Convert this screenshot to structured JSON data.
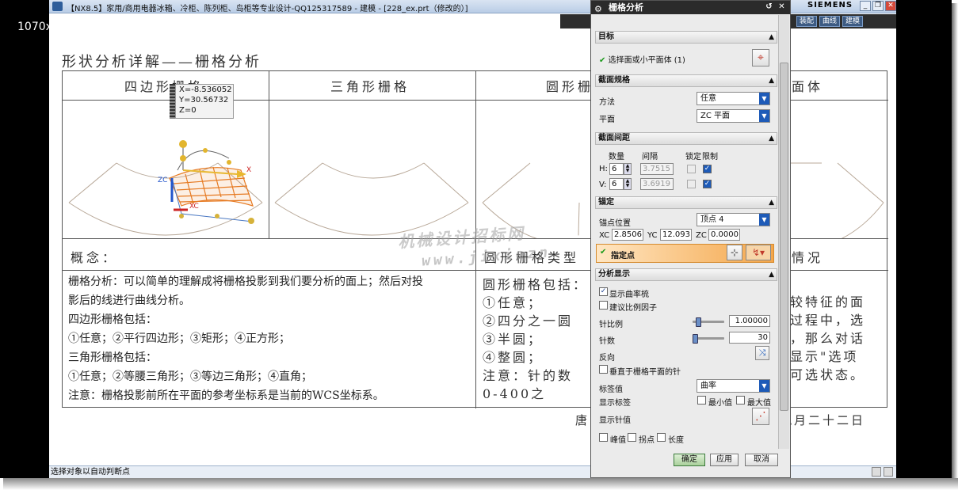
{
  "overlay": {
    "resolution_label": "1070x604(78%)"
  },
  "app": {
    "title": "【NX8.5】家用/商用电器冰箱、冷柜、陈列柜、岛柜等专业设计-QQ125317589 - 建模 - [228_ex.prt（修改的）]",
    "brand": "SIEMENS",
    "ribbon_tabs": [
      "装配",
      "曲线",
      "建模"
    ],
    "status_text": "选择对象以自动判断点"
  },
  "drawing": {
    "doc_title": "形状分析详解——栅格分析",
    "column_headers": [
      "四边形栅格",
      "三角形栅格",
      "圆形栅格",
      "曲面体"
    ],
    "concept_label": "概念：",
    "circle_type_label": "圆形栅格类型",
    "situation_label": "情况",
    "left_lines": [
      "栅格分析：可以简单的理解成将栅格投影到我们要分析的面上；然后对投",
      "影后的线进行曲线分析。",
      "四边形栅格包括：",
      "①任意；②平行四边形；③矩形；④正方形；",
      "三角形栅格包括：",
      "①任意；②等腰三角形；③等边三角形；④直角；",
      "注意：栅格投影前所在平面的参考坐标系是当前的WCS坐标系。"
    ],
    "mid_lines": [
      "圆形栅格包括：",
      "①任意；",
      "②四分之一圆",
      "③半圆；",
      "④整圆；",
      "注意：针的数",
      "0-400之"
    ],
    "right_lines": [
      "较特征的面",
      "过程中，选",
      "，那么对话",
      "显示\"选项",
      "可选状态。"
    ],
    "date_left": "唐",
    "date_right": "九月二十二日",
    "watermark_line1": "机械设计招标网",
    "watermark_line2": "www.jixiezn",
    "coord_tip": {
      "x": "X=-8.536052",
      "y": "Y=30.56732",
      "z": "Z=0"
    },
    "axis_labels": {
      "zc": "ZC",
      "xc": "XC",
      "x": "X"
    }
  },
  "dialog": {
    "title": "栅格分析",
    "target": {
      "header": "目标",
      "select_label": "选择面或小平面体 (1)"
    },
    "section_spec": {
      "header": "截面规格",
      "method_label": "方法",
      "method_value": "任意",
      "plane_label": "平面",
      "plane_value": "ZC 平面"
    },
    "spacing": {
      "header": "截面间距",
      "col_count": "数量",
      "col_interval": "间隔",
      "col_lock": "锁定",
      "col_limit": "限制",
      "h_label": "H:",
      "h_count": "6",
      "h_interval": "3.7515",
      "v_label": "V:",
      "v_count": "6",
      "v_interval": "3.6919"
    },
    "anchor": {
      "header": "锚定",
      "pos_label": "锚点位置",
      "pos_value": "顶点 4",
      "xc_label": "XC",
      "xc_value": "2.8506",
      "yc_label": "YC",
      "yc_value": "12.093",
      "zc_label": "ZC",
      "zc_value": "0.0000",
      "specify_label": "指定点"
    },
    "analysis": {
      "header": "分析显示",
      "show_curvature": "显示曲率梳",
      "proportional": "建议比例因子",
      "scale_label": "针比例",
      "scale_value": "1.00000",
      "count_label": "针数",
      "count_value": "30",
      "reverse_label": "反向",
      "perp_label": "垂直于栅格平面的针",
      "label_value_label": "标签值",
      "label_value": "曲率",
      "show_label_label": "显示标签",
      "min_label": "最小值",
      "max_label": "最大值",
      "show_needle_label": "显示针值",
      "peak_label": "峰值",
      "inflection_label": "拐点",
      "length_label": "长度"
    },
    "buttons": {
      "ok": "确定",
      "apply": "应用",
      "cancel": "取消"
    }
  }
}
